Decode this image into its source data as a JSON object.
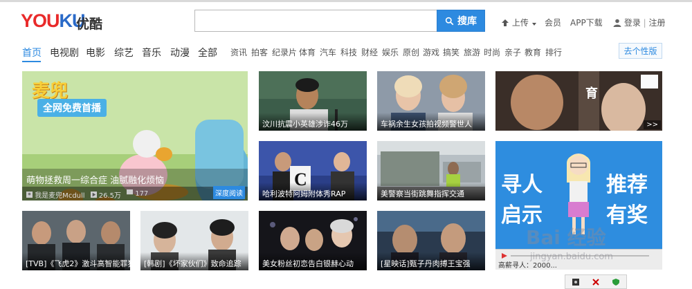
{
  "header": {
    "logo_part1": "YOU",
    "logo_part2": "KU",
    "logo_cn": "优酷",
    "search_placeholder": "",
    "search_button": "搜库",
    "upload": "上传",
    "member": "会员",
    "app_download": "APP下载",
    "login": "登录",
    "separator": "|",
    "register": "注册"
  },
  "nav": {
    "main": [
      "首页",
      "电视剧",
      "电影",
      "综艺",
      "音乐",
      "动漫",
      "全部"
    ],
    "sub": [
      "资讯",
      "拍客",
      "纪录片",
      "体育",
      "汽车",
      "科技",
      "财经",
      "娱乐",
      "原创",
      "游戏",
      "搞笑",
      "旅游",
      "时尚",
      "亲子",
      "教育",
      "排行"
    ],
    "personal": "去个性版"
  },
  "feature": {
    "title_art": "麦兜",
    "subtitle_art": "全网免费首播",
    "caption": "萌物拯救周一综合症 油腻融化烦恼",
    "author": "我是麦兜Mcdull",
    "plays": "26.5万",
    "comments": "177",
    "badge": "深度阅读"
  },
  "cards": [
    {
      "caption": "汶川抗震小英雄涉诈46万"
    },
    {
      "caption": "车祸余生女孩拍视频警世人"
    },
    {
      "caption": "",
      "tag": ">>"
    },
    {
      "caption": "哈利波特阿姆附体秀RAP"
    },
    {
      "caption": "美警察当街跳舞指挥交通"
    },
    {
      "caption": "[TVB]《飞虎2》激斗高智能罪犯"
    },
    {
      "caption": "[韩剧]《坏家伙们》致命追踪"
    },
    {
      "caption": "美女粉丝初恋告白银赫心动"
    },
    {
      "caption": "[星映话]甄子丹肉搏王宝强"
    }
  ],
  "ad": {
    "line1a": "寻人",
    "line1b": "推荐",
    "line2a": "启示",
    "line2b": "有奖",
    "player_caption": "高薪寻人：2000..."
  },
  "watermark": {
    "text": "Bai 经验",
    "url": "jingyan.baidu.com"
  },
  "colors": {
    "accent": "#2d8ae0",
    "logo_red": "#e92a2a",
    "logo_blue": "#2a6ac8"
  }
}
